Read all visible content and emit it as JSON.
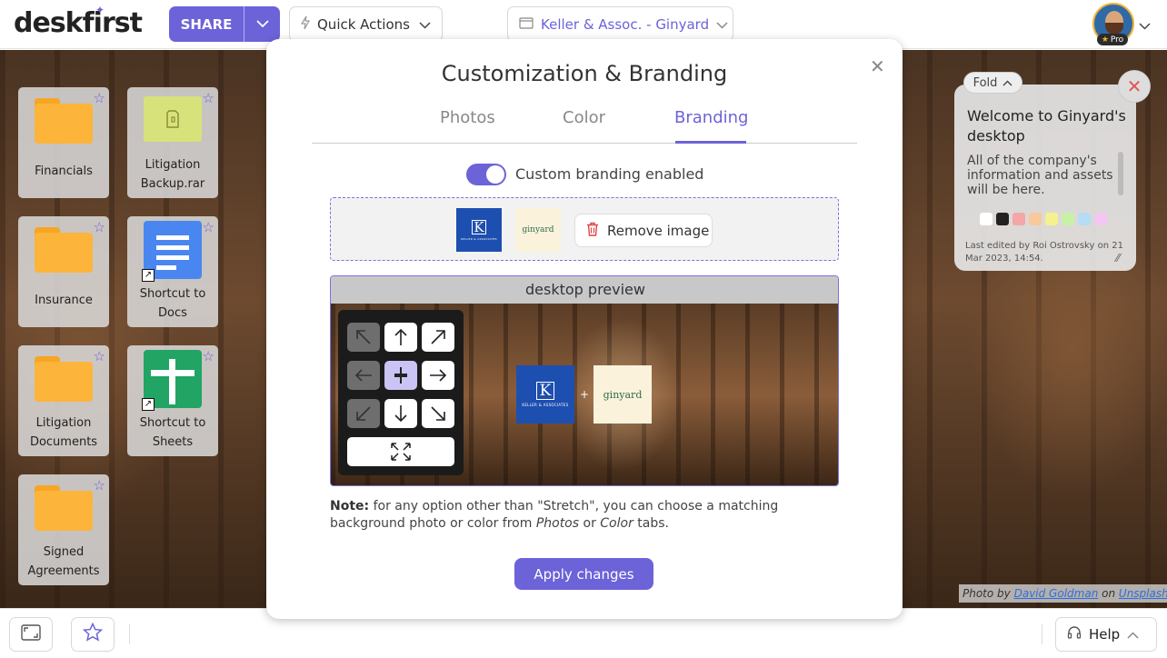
{
  "app": {
    "logo_text": "deskfirst",
    "brand_color": "#6c63d9"
  },
  "topbar": {
    "share_label": "SHARE",
    "quick_actions_label": "Quick Actions",
    "company_label": "Keller & Assoc. - Ginyard",
    "pro_label": "Pro"
  },
  "desktop": {
    "tiles": [
      {
        "name": "Financials",
        "type": "folder"
      },
      {
        "name": "Litigation Backup.rar",
        "type": "rar"
      },
      {
        "name": "Insurance",
        "type": "folder"
      },
      {
        "name": "Shortcut to Docs",
        "type": "google-docs"
      },
      {
        "name": "Litigation Documents",
        "type": "folder"
      },
      {
        "name": "Shortcut to Sheets",
        "type": "google-sheets"
      },
      {
        "name": "Signed Agreements",
        "type": "folder"
      }
    ],
    "photo_credit": {
      "prefix": "Photo by",
      "author": "David Goldman",
      "middle": "on",
      "source": "Unsplash"
    }
  },
  "note_widget": {
    "fold_label": "Fold",
    "title": "Welcome to Ginyard's desktop",
    "body": "All of the company's information and assets will be here.",
    "swatches": [
      "#ffffff",
      "#222222",
      "#f4a7a7",
      "#f8c99a",
      "#f6f08e",
      "#c8f0a6",
      "#b6dcf6",
      "#f4c6f2"
    ],
    "edited": "Last edited by Roi Ostrovsky on 21 Mar 2023, 14:54."
  },
  "modal": {
    "title": "Customization & Branding",
    "tabs": [
      {
        "label": "Photos",
        "active": false
      },
      {
        "label": "Color",
        "active": false
      },
      {
        "label": "Branding",
        "active": true
      }
    ],
    "toggle_label": "Custom branding enabled",
    "toggle_on": true,
    "logos": {
      "keller_letter": "K",
      "keller_sub": "KELLER & ASSOCIATES",
      "ginyard": "ginyard"
    },
    "remove_image_label": "Remove image",
    "preview_title": "desktop preview",
    "preview_plus": "+",
    "note": {
      "bold": "Note:",
      "text1": " for any option other than \"Stretch\", you can choose a matching background photo or color from ",
      "photos": "Photos",
      "or": " or ",
      "color": "Color",
      "text2": " tabs."
    },
    "apply_label": "Apply changes"
  },
  "bottombar": {
    "help_label": "Help"
  }
}
